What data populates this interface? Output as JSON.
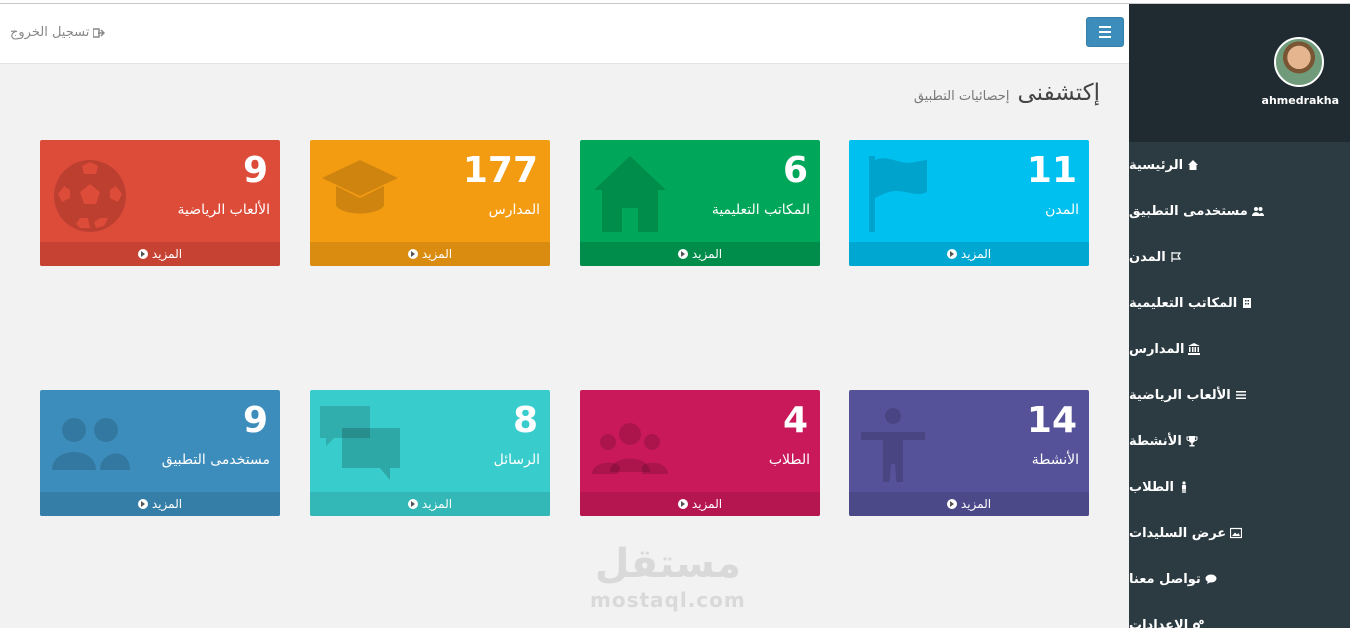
{
  "header": {
    "logout_label": "تسجيل الخروج"
  },
  "page": {
    "title": "إكتشفنى",
    "subtitle": "إحصائيات التطبيق"
  },
  "user": {
    "name": "ahmedrakha"
  },
  "sidebar": {
    "items": [
      {
        "label": "الرئيسية",
        "icon": "home-icon"
      },
      {
        "label": "مستخدمى التطبيق",
        "icon": "users-icon"
      },
      {
        "label": "المدن",
        "icon": "flag-icon"
      },
      {
        "label": "المكاتب التعليمية",
        "icon": "building-icon"
      },
      {
        "label": "المدارس",
        "icon": "institution-icon"
      },
      {
        "label": "الألعاب الرياضية",
        "icon": "list-icon"
      },
      {
        "label": "الأنشطة",
        "icon": "trophy-icon"
      },
      {
        "label": "الطلاب",
        "icon": "male-icon"
      },
      {
        "label": "عرض السليدات",
        "icon": "image-icon"
      },
      {
        "label": "تواصل معنا",
        "icon": "comment-icon"
      },
      {
        "label": "الاعدادات",
        "icon": "cogs-icon"
      }
    ]
  },
  "more_label": "المزيد",
  "boxes": [
    {
      "value": "11",
      "label": "المدن",
      "color": "#00c0ef",
      "footer": "#00a7d0",
      "icon": "flag-icon"
    },
    {
      "value": "6",
      "label": "المكاتب التعليمية",
      "color": "#00a65a",
      "footer": "#008d4c",
      "icon": "home-icon"
    },
    {
      "value": "177",
      "label": "المدارس",
      "color": "#f39c12",
      "footer": "#da8c10",
      "icon": "graduation-cap-icon"
    },
    {
      "value": "9",
      "label": "الألعاب الرياضية",
      "color": "#dd4b39",
      "footer": "#c64333",
      "icon": "soccer-ball-icon"
    },
    {
      "value": "14",
      "label": "الأنشطة",
      "color": "#555299",
      "footer": "#4c4989",
      "icon": "person-icon"
    },
    {
      "value": "4",
      "label": "الطلاب",
      "color": "#ca195a",
      "footer": "#b51650",
      "icon": "group-icon"
    },
    {
      "value": "8",
      "label": "الرسائل",
      "color": "#39cccc",
      "footer": "#33b7b7",
      "icon": "comments-icon"
    },
    {
      "value": "9",
      "label": "مستخدمى التطبيق",
      "color": "#3c8dbc",
      "footer": "#357ea8",
      "icon": "users-icon"
    }
  ],
  "watermark": {
    "arabic": "مستقل",
    "latin": "mostaql.com"
  }
}
